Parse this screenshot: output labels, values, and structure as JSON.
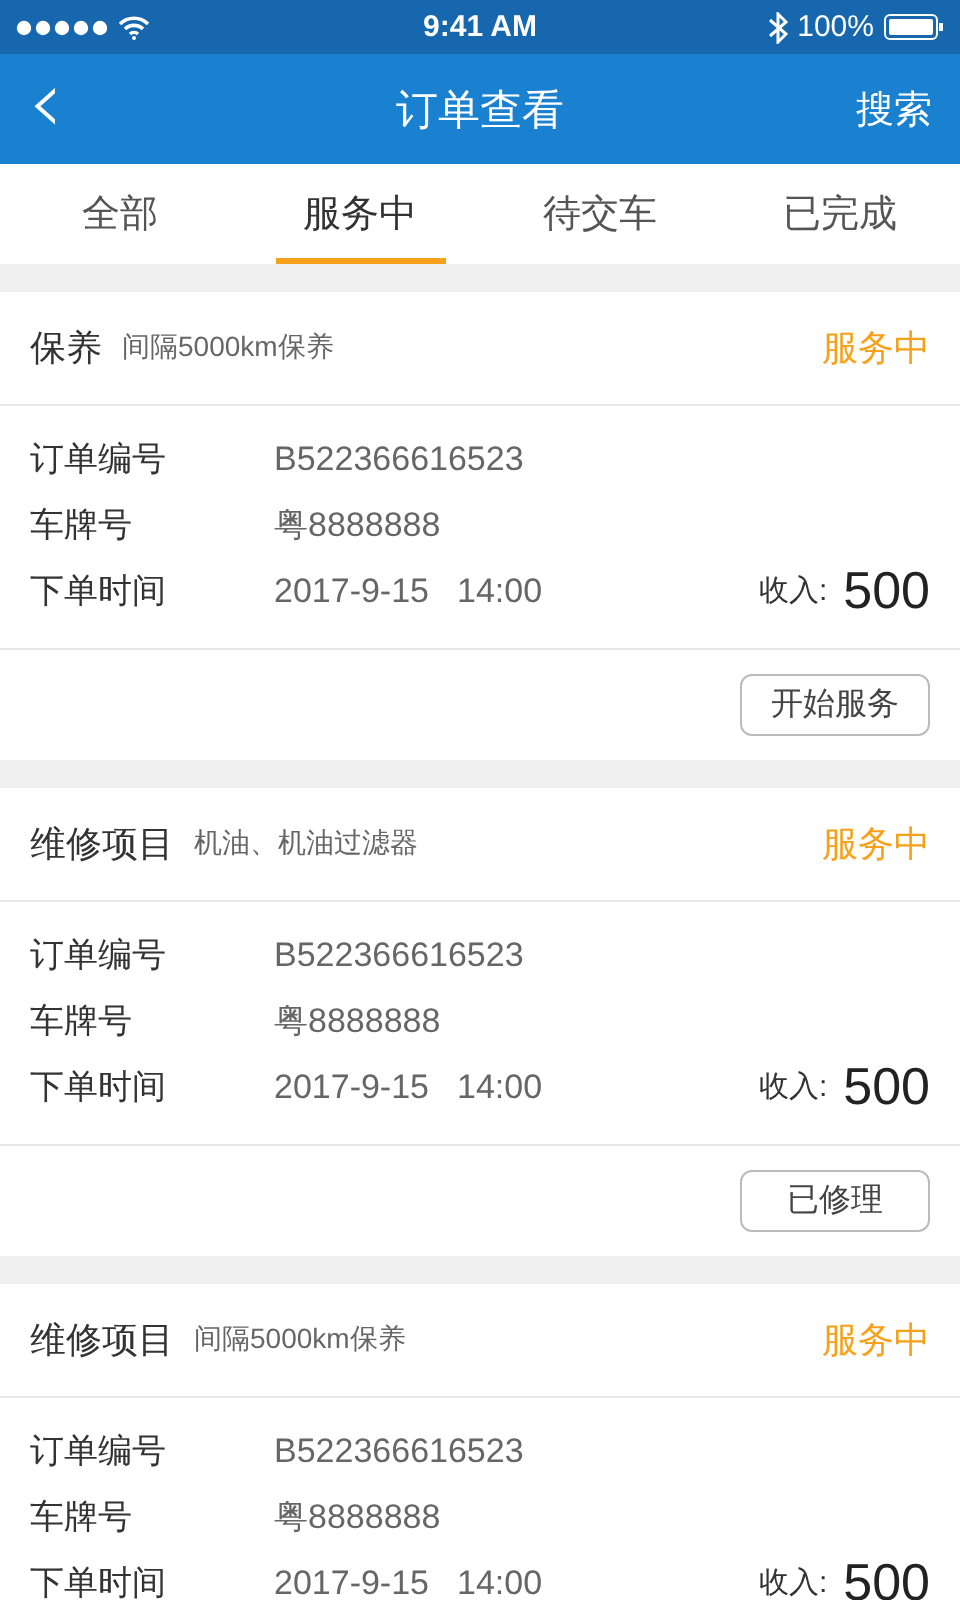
{
  "status_bar": {
    "time": "9:41 AM",
    "battery": "100%"
  },
  "nav": {
    "back": "‹",
    "title": "订单查看",
    "action": "搜索"
  },
  "tabs": [
    {
      "label": "全部",
      "selected": false
    },
    {
      "label": "服务中",
      "selected": true
    },
    {
      "label": "待交车",
      "selected": false
    },
    {
      "label": "已完成",
      "selected": false
    }
  ],
  "orders": [
    {
      "type": "保养",
      "note": "间隔5000km保养",
      "status": "服务中",
      "order_no_label": "订单编号",
      "order_no": "B522366616523",
      "plate_label": "车牌号",
      "plate": "粤8888888",
      "time_label": "下单时间",
      "date": "2017-9-15",
      "time": "14:00",
      "income_label": "收入:",
      "income": "500",
      "button": "开始服务"
    },
    {
      "type": "维修项目",
      "note": "机油、机油过滤器",
      "status": "服务中",
      "order_no_label": "订单编号",
      "order_no": "B522366616523",
      "plate_label": "车牌号",
      "plate": "粤8888888",
      "time_label": "下单时间",
      "date": "2017-9-15",
      "time": "14:00",
      "income_label": "收入:",
      "income": "500",
      "button": "已修理"
    },
    {
      "type": "维修项目",
      "note": "间隔5000km保养",
      "status": "服务中",
      "order_no_label": "订单编号",
      "order_no": "B522366616523",
      "plate_label": "车牌号",
      "plate": "粤8888888",
      "time_label": "下单时间",
      "date": "2017-9-15",
      "time": "14:00",
      "income_label": "收入:",
      "income": "500"
    }
  ]
}
